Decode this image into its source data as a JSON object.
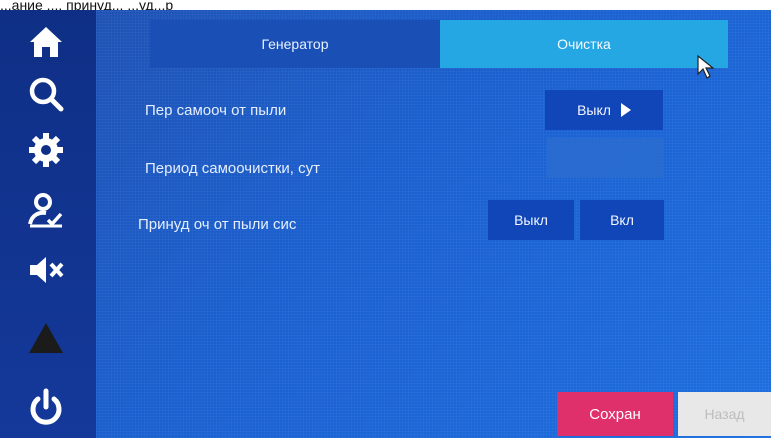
{
  "top_caption": "...ание ..., принуд... ...уд...р",
  "sidebar": {
    "items": [
      {
        "icon": "home-icon"
      },
      {
        "icon": "search-icon"
      },
      {
        "icon": "gear-icon"
      },
      {
        "icon": "user-check-icon"
      },
      {
        "icon": "mute-icon"
      },
      {
        "icon": "warning-icon"
      },
      {
        "icon": "power-icon"
      }
    ]
  },
  "tabs": [
    {
      "label": "Генератор",
      "active": false
    },
    {
      "label": "Очистка",
      "active": true
    }
  ],
  "settings": {
    "row1_label": "Пер самооч от пыли",
    "row1_value": "Выкл",
    "row2_label": "Период самоочистки, сут",
    "row2_value": "",
    "row3_label": "Принуд оч от пыли сис",
    "row3_off": "Выкл",
    "row3_on": "Вкл"
  },
  "footer": {
    "save": "Сохран",
    "back": "Назад"
  },
  "colors": {
    "screen_bg": "#1a5fcf",
    "sidebar_bg": "#0f2f86",
    "active_tab": "#25a7e3",
    "button": "#1046b8",
    "save": "#e0306b"
  }
}
